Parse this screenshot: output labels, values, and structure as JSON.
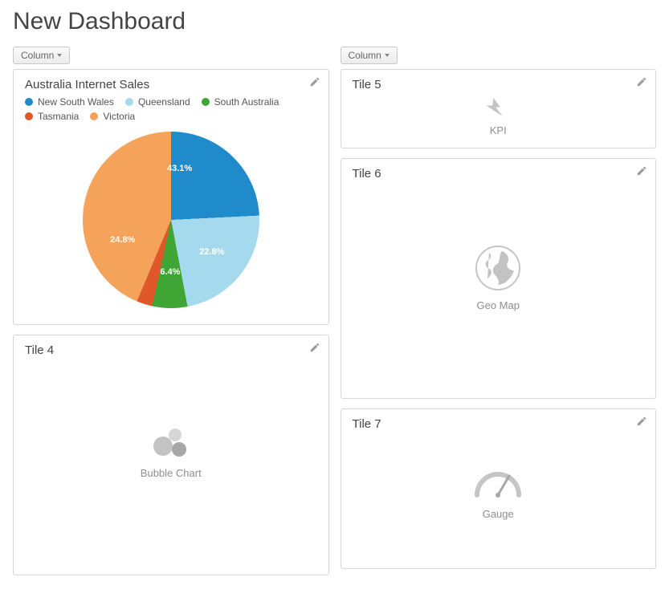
{
  "page_title": "New Dashboard",
  "column_button_label": "Column",
  "left": {
    "tiles": [
      {
        "title": "Australia Internet Sales",
        "type": "pie",
        "legend": [
          {
            "label": "New South Wales",
            "color": "#1f8bca"
          },
          {
            "label": "Queensland",
            "color": "#a5d9ee"
          },
          {
            "label": "South Australia",
            "color": "#3fa535"
          },
          {
            "label": "Tasmania",
            "color": "#e0582a"
          },
          {
            "label": "Victoria",
            "color": "#f5a35b"
          }
        ]
      },
      {
        "title": "Tile 4",
        "type": "placeholder",
        "placeholder_label": "Bubble Chart"
      }
    ]
  },
  "right": {
    "tiles": [
      {
        "title": "Tile 5",
        "type": "placeholder",
        "placeholder_label": "KPI"
      },
      {
        "title": "Tile 6",
        "type": "placeholder",
        "placeholder_label": "Geo Map"
      },
      {
        "title": "Tile 7",
        "type": "placeholder",
        "placeholder_label": "Gauge"
      }
    ]
  },
  "chart_data": {
    "type": "pie",
    "title": "Australia Internet Sales",
    "series": [
      {
        "name": "New South Wales",
        "value": 43.1,
        "color": "#1f8bca"
      },
      {
        "name": "Queensland",
        "value": 22.8,
        "color": "#a5d9ee"
      },
      {
        "name": "South Australia",
        "value": 6.4,
        "color": "#3fa535"
      },
      {
        "name": "Tasmania",
        "value": 2.9,
        "color": "#e0582a"
      },
      {
        "name": "Victoria",
        "value": 24.8,
        "color": "#f5a35b"
      }
    ],
    "value_labels_shown": [
      "43.1%",
      "22.8%",
      "6.4%",
      "24.8%"
    ]
  }
}
